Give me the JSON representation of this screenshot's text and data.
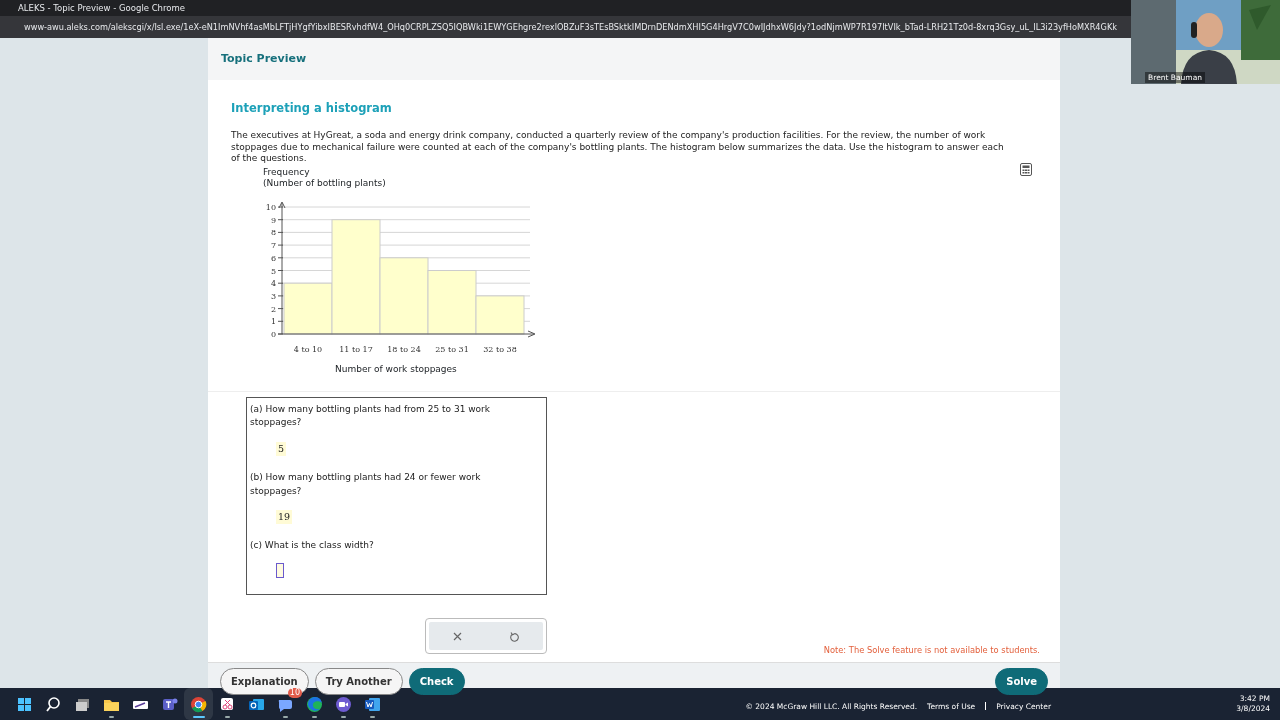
{
  "window": {
    "title": "ALEKS - Topic Preview - Google Chrome"
  },
  "address_bar": {
    "url": "www-awu.aleks.com/alekscgi/x/Isl.exe/1eX-eN1ImNVhf4asMbLFTjHYgfYibxIBESRvhdfW4_OHq0CRPLZSQ5IQBWki1EWYGEhgre2rexlOBZuF3sTEsBSktkIMDrnDENdmXHI5G4HrgV7C0wIJdhxW6Jdy?1odNjmWP7R197ItVIk_bTad-LRH21Tz0d-8xrq3Gsy_uL_IL3i23yfHoMXR4GKk"
  },
  "video_overlay": {
    "kind": "picture",
    "participant": "Brent Bauman"
  },
  "header": {
    "title": "Topic Preview"
  },
  "problem": {
    "title": "Interpreting a histogram",
    "text": "The executives at HyGreat, a soda and energy drink company, conducted a quarterly review of the company's production facilities. For the review, the number of work stoppages due to mechanical failure were counted at each of the company's bottling plants. The histogram below summarizes the data. Use the histogram to answer each of the questions.",
    "chart_data": {
      "type": "bar",
      "ylabel": "Frequency\n(Number of bottling plants)",
      "xlabel": "Number of work stoppages",
      "categories": [
        "4 to 10",
        "11 to 17",
        "18 to 24",
        "25 to 31",
        "32 to 38"
      ],
      "values": [
        4,
        9,
        6,
        5,
        3
      ],
      "ylim": [
        0,
        10
      ],
      "grid": true,
      "yticks": [
        0,
        1,
        2,
        3,
        4,
        5,
        6,
        7,
        8,
        9,
        10
      ]
    }
  },
  "questions": [
    {
      "kind": "answered",
      "question": "(a) How many bottling plants had from 25 to 31 work stoppages?",
      "answer": "5"
    },
    {
      "kind": "answered",
      "question": "(b) How many bottling plants had 24 or fewer work stoppages?",
      "answer": "19"
    },
    {
      "kind": "empty",
      "question": "(c) What is the class width?"
    }
  ],
  "answer_tools": [
    {
      "kind": "clear"
    },
    {
      "kind": "undo"
    }
  ],
  "note": "Note: The Solve feature is not available to students.",
  "buttons": [
    {
      "kind": "outline",
      "label": "Explanation"
    },
    {
      "kind": "outline",
      "label": "Try Another"
    },
    {
      "kind": "primary",
      "label": "Check"
    }
  ],
  "solve_button": {
    "label": "Solve"
  },
  "footer": {
    "copyright": "© 2024 McGraw Hill LLC. All Rights Reserved.",
    "links": [
      "Terms of Use",
      "Privacy Center"
    ]
  },
  "taskbar": {
    "apps": [
      {
        "kind": "start"
      },
      {
        "kind": "search"
      },
      {
        "kind": "taskview"
      },
      {
        "kind": "folder",
        "running": true
      },
      {
        "kind": "pen"
      },
      {
        "kind": "teams"
      },
      {
        "kind": "chrome",
        "running": true,
        "active": true
      },
      {
        "kind": "snip",
        "running": true
      },
      {
        "kind": "outlook"
      },
      {
        "kind": "chat",
        "running": true,
        "badge": "10"
      },
      {
        "kind": "edge",
        "running": true
      },
      {
        "kind": "zoom",
        "running": true
      },
      {
        "kind": "word",
        "running": true
      }
    ],
    "time": "3:42 PM",
    "date": "3/8/2024"
  }
}
